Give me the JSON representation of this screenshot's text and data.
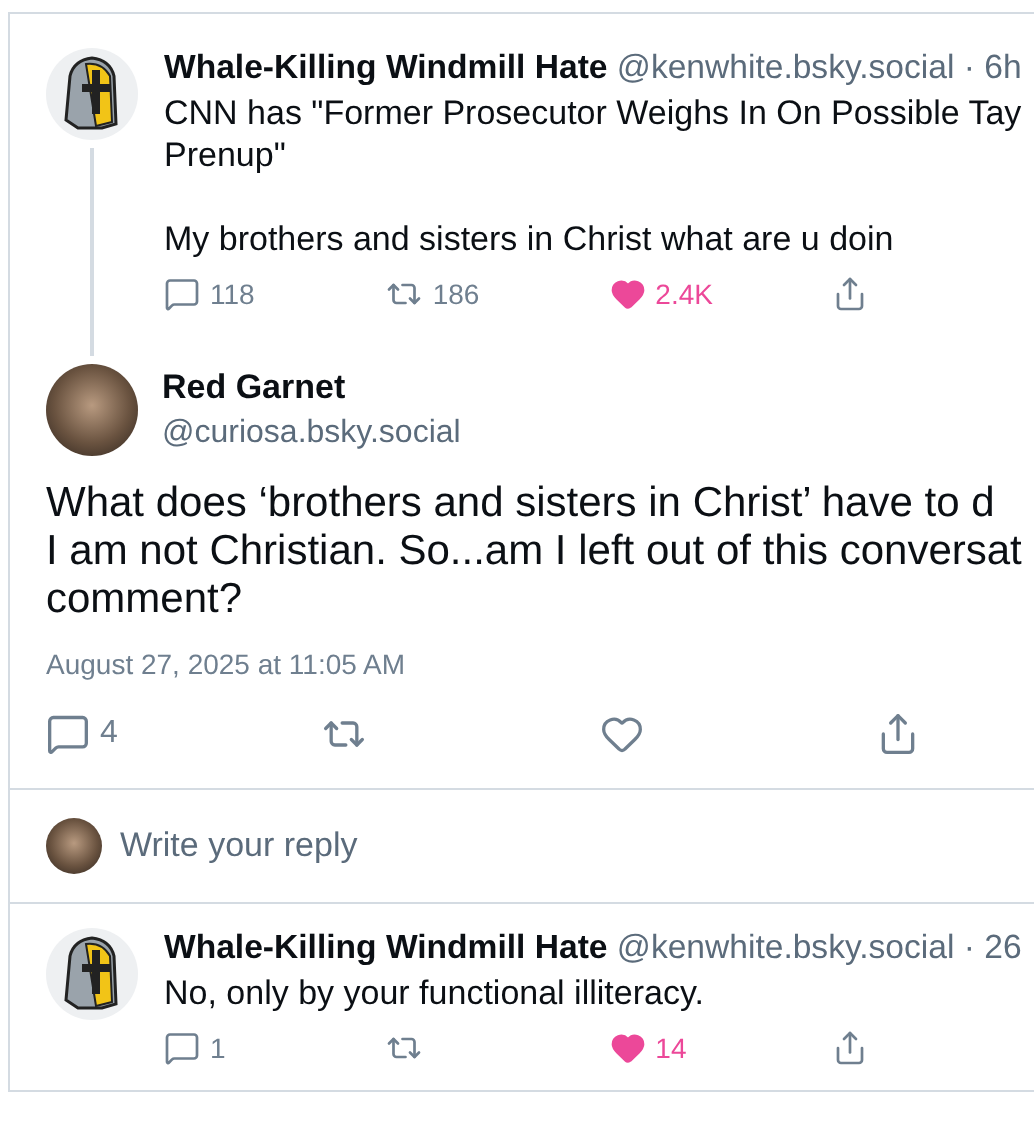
{
  "parent_post": {
    "author": {
      "avatar": {
        "kind": "helmet"
      },
      "display_name": "Whale-Killing Windmill Hate",
      "handle": "@kenwhite.bsky.social",
      "time": "· 6h"
    },
    "text": "CNN has \"Former Prosecutor Weighs In On Possible Tay\nPrenup\"\n\nMy brothers and sisters in Christ what are u doin",
    "actions": {
      "replies": "118",
      "reposts": "186",
      "likes": "2.4K",
      "liked": true
    }
  },
  "focused_post": {
    "author": {
      "avatar": {
        "kind": "photo"
      },
      "display_name": "Red Garnet",
      "handle": "@curiosa.bsky.social"
    },
    "text": "What does ‘brothers and sisters in Christ’ have to d\nI am not Christian. So...am I left out of this conversat\ncomment?",
    "date": "August 27, 2025 at 11:05 AM",
    "actions": {
      "replies": "4",
      "liked": false
    }
  },
  "composer": {
    "avatar": {
      "kind": "photo"
    },
    "placeholder": "Write your reply"
  },
  "reply": {
    "author": {
      "avatar": {
        "kind": "helmet"
      },
      "display_name": "Whale-Killing Windmill Hate",
      "handle": "@kenwhite.bsky.social",
      "time": "· 26"
    },
    "text": "No, only by your functional illiteracy.",
    "actions": {
      "replies": "1",
      "likes": "14",
      "liked": true
    }
  }
}
